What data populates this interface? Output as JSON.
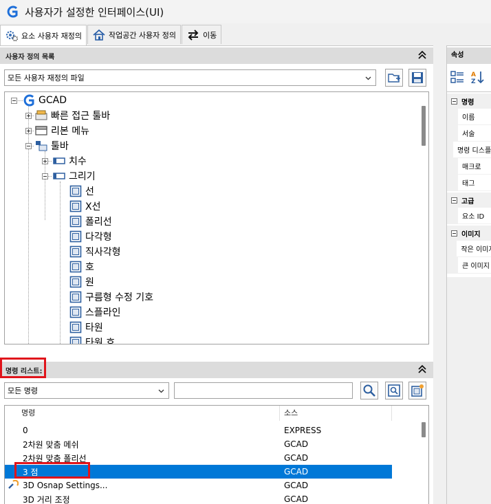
{
  "window": {
    "title": "사용자가 설정한 인터페이스(UI)"
  },
  "tabs": [
    {
      "label": "요소 사용자 재정의"
    },
    {
      "label": "작업공간 사용자 정의"
    },
    {
      "label": "이동"
    }
  ],
  "customize_panel": {
    "header": "사용자 정의 목록",
    "file_combo_value": "모든 사용자 재정의 파일"
  },
  "tree": {
    "root": "GCAD",
    "items": [
      {
        "label": "빠른 접근 툴바"
      },
      {
        "label": "리본 메뉴"
      },
      {
        "label": "툴바"
      },
      {
        "label": "치수"
      },
      {
        "label": "그리기"
      },
      {
        "label": "선"
      },
      {
        "label": "X선"
      },
      {
        "label": "폴리선"
      },
      {
        "label": "다각형"
      },
      {
        "label": "직사각형"
      },
      {
        "label": "호"
      },
      {
        "label": "원"
      },
      {
        "label": "구름형 수정 기호"
      },
      {
        "label": "스플라인"
      },
      {
        "label": "타원"
      },
      {
        "label": "타원 호"
      }
    ]
  },
  "command_list": {
    "header": "명령 리스트:",
    "filter_value": "모든 명령",
    "search_value": "",
    "columns": {
      "name": "명령",
      "source": "소스"
    },
    "rows": [
      {
        "name": "0",
        "source": "EXPRESS"
      },
      {
        "name": "2차원 맞춤 메쉬",
        "source": "GCAD"
      },
      {
        "name": "2차원 맞춤 폴리선",
        "source": "GCAD"
      },
      {
        "name": "3 점",
        "source": "GCAD"
      },
      {
        "name": "3D Osnap Settings...",
        "source": "GCAD"
      },
      {
        "name": "3D 거리 조정",
        "source": "GCAD"
      }
    ]
  },
  "properties": {
    "header": "속성",
    "categories": [
      {
        "label": "명령",
        "rows": [
          "이름",
          "서술",
          "명령 디스플레이 이름",
          "매크로",
          "태그"
        ]
      },
      {
        "label": "고급",
        "rows": [
          "요소 ID"
        ]
      },
      {
        "label": "이미지",
        "rows": [
          "작은 이미지",
          "큰 이미지"
        ]
      }
    ]
  },
  "colors": {
    "selection": "#0078d7",
    "highlight_box": "#e0141b",
    "header_bg": "#dcdcdc"
  }
}
